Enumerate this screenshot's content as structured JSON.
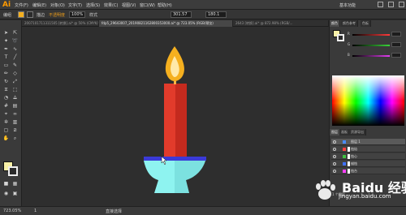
{
  "app": {
    "logo": "Ai"
  },
  "menubar": {
    "items": [
      "文件(F)",
      "编辑(E)",
      "对象(O)",
      "文字(T)",
      "选择(S)",
      "效果(C)",
      "视图(V)",
      "窗口(W)",
      "帮助(H)"
    ],
    "workspace": "基本功能"
  },
  "control_bar": {
    "label_path": "编组",
    "stroke_label": "描边",
    "opacity_label": "不透明度",
    "opacity_value": "100%",
    "style_label": "样式",
    "x_value": "301.57",
    "y_value": "180.1"
  },
  "documents": {
    "tabs": [
      {
        "label": "2007101711311505 [转换].ai* @ 50% (CMYK/预览)",
        "active": false
      },
      {
        "label": "fdp5_29643007_20190821162800353000.ai* @ 723.05% (RGB/预览)",
        "active": true
      },
      {
        "label": "2643 [转换].ai* @ 872.98% (RGB/...",
        "active": false
      }
    ]
  },
  "color_panel": {
    "tabs": [
      "颜色",
      "颜色参考",
      "色板"
    ],
    "sliders": [
      {
        "label": "R",
        "value": "",
        "color": "#ff3b3b"
      },
      {
        "label": "G",
        "value": "",
        "color": "#39d339"
      },
      {
        "label": "B",
        "value": "",
        "color": "#3b5bff"
      }
    ]
  },
  "layers_panel": {
    "tabs": [
      "图层",
      "画板",
      "资源导出"
    ],
    "layers": [
      {
        "name": "图层 1",
        "color": "#4a8cff",
        "selected": true
      },
      {
        "name": "烛焰",
        "color": "#ff4040",
        "selected": false
      },
      {
        "name": "烛心",
        "color": "#40c040",
        "selected": false
      },
      {
        "name": "蜡烛",
        "color": "#4070ff",
        "selected": false
      },
      {
        "name": "烛台",
        "color": "#ff40ff",
        "selected": false
      }
    ],
    "footer": "1 个图层"
  },
  "status": {
    "zoom": "723.05%",
    "page": "1",
    "tool_name": "直接选择"
  },
  "watermark": {
    "main": "Baidu 经验",
    "url": "jingyan.baidu.com"
  },
  "canvas_colors": {
    "flame_outer": "#f5b01f",
    "flame_inner": "#ffe9a8",
    "candle_left": "#e23b2b",
    "candle_right": "#c42a1e",
    "plate": "#3a3ad8",
    "holder": "#8ef3f0"
  }
}
